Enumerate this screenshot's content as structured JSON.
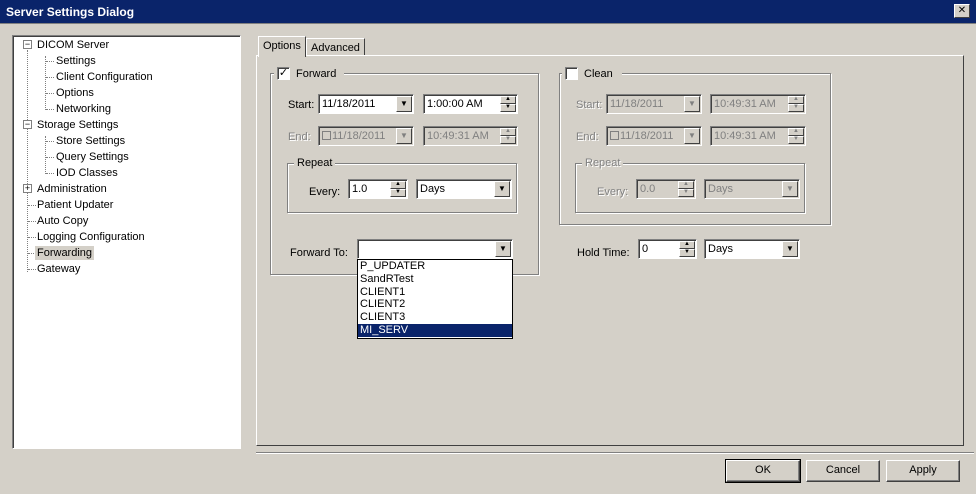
{
  "window": {
    "title": "Server Settings Dialog",
    "close_glyph": "✕"
  },
  "tree": {
    "items": [
      {
        "label": "DICOM Server",
        "expander": "−"
      },
      {
        "label": "Settings"
      },
      {
        "label": "Client Configuration"
      },
      {
        "label": "Options"
      },
      {
        "label": "Networking"
      },
      {
        "label": "Storage Settings",
        "expander": "−"
      },
      {
        "label": "Store Settings"
      },
      {
        "label": "Query Settings"
      },
      {
        "label": "IOD Classes"
      },
      {
        "label": "Administration",
        "expander": "+"
      },
      {
        "label": "Patient Updater"
      },
      {
        "label": "Auto Copy"
      },
      {
        "label": "Logging Configuration"
      },
      {
        "label": "Forwarding"
      },
      {
        "label": "Gateway"
      }
    ]
  },
  "tabs": [
    {
      "label": "Options"
    },
    {
      "label": "Advanced"
    }
  ],
  "forward": {
    "checkbox_label": "Forward",
    "checked_glyph": "✓",
    "start_label": "Start:",
    "start_date": "11/18/2011",
    "start_time": "1:00:00 AM",
    "end_label": "End:",
    "end_date": "11/18/2011",
    "end_time": "10:49:31 AM",
    "repeat_title": "Repeat",
    "every_label": "Every:",
    "every_value": "1.0",
    "every_unit": "Days",
    "forward_to_label": "Forward To:",
    "forward_to_value": "",
    "options": [
      "P_UPDATER",
      "SandRTest",
      "CLIENT1",
      "CLIENT2",
      "CLIENT3",
      "MI_SERV"
    ]
  },
  "clean": {
    "checkbox_label": "Clean",
    "start_label": "Start:",
    "start_date": "11/18/2011",
    "start_time": "10:49:31 AM",
    "end_label": "End:",
    "end_date": "11/18/2011",
    "end_time": "10:49:31 AM",
    "repeat_title": "Repeat",
    "every_label": "Every:",
    "every_value": "0.0",
    "every_unit": "Days",
    "hold_time_label": "Hold Time:",
    "hold_time_value": "0",
    "hold_time_unit": "Days"
  },
  "buttons": {
    "ok": "OK",
    "cancel": "Cancel",
    "apply": "Apply"
  },
  "glyphs": {
    "down": "▼",
    "up": "▲"
  }
}
